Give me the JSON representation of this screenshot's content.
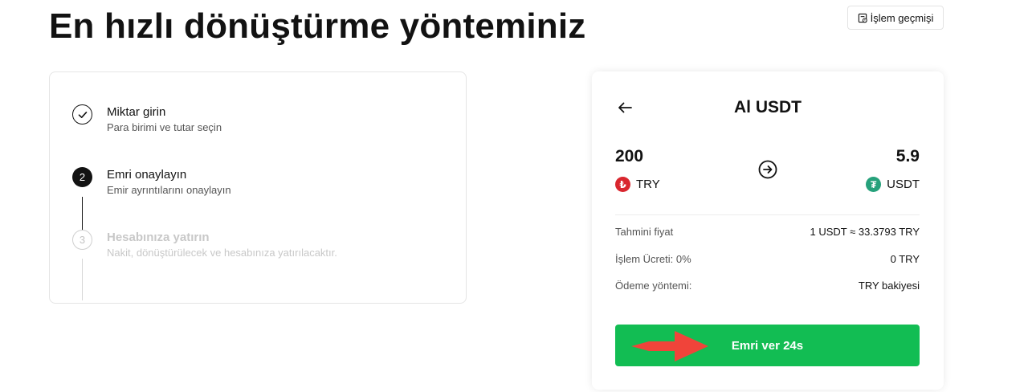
{
  "header": {
    "title": "En hızlı dönüştürme yönteminiz",
    "history_button": "İşlem geçmişi"
  },
  "steps": [
    {
      "number": "",
      "title": "Miktar girin",
      "description": "Para birimi ve tutar seçin",
      "state": "done"
    },
    {
      "number": "2",
      "title": "Emri onaylayın",
      "description": "Emir ayrıntılarını onaylayın",
      "state": "active"
    },
    {
      "number": "3",
      "title": "Hesabınıza yatırın",
      "description": "Nakit, dönüştürülecek ve hesabınıza yatırılacaktır.",
      "state": "pending"
    }
  ],
  "order": {
    "title": "Al USDT",
    "from_amount": "200",
    "from_currency": "TRY",
    "from_currency_icon": "lira-coin-icon",
    "to_amount": "5.9",
    "to_currency": "USDT",
    "to_currency_icon": "tether-coin-icon",
    "details": [
      {
        "label": "Tahmini fiyat",
        "value": "1 USDT ≈ 33.3793 TRY"
      },
      {
        "label": "İşlem Ücreti: 0%",
        "value": "0 TRY"
      },
      {
        "label": "Ödeme yöntemi:",
        "value": "TRY bakiyesi"
      }
    ],
    "submit_label": "Emri ver 24s"
  },
  "colors": {
    "accent_green": "#12bd53",
    "try_red": "#d9262e",
    "usdt_green": "#26a17b",
    "annotation_arrow": "#f0443a"
  }
}
